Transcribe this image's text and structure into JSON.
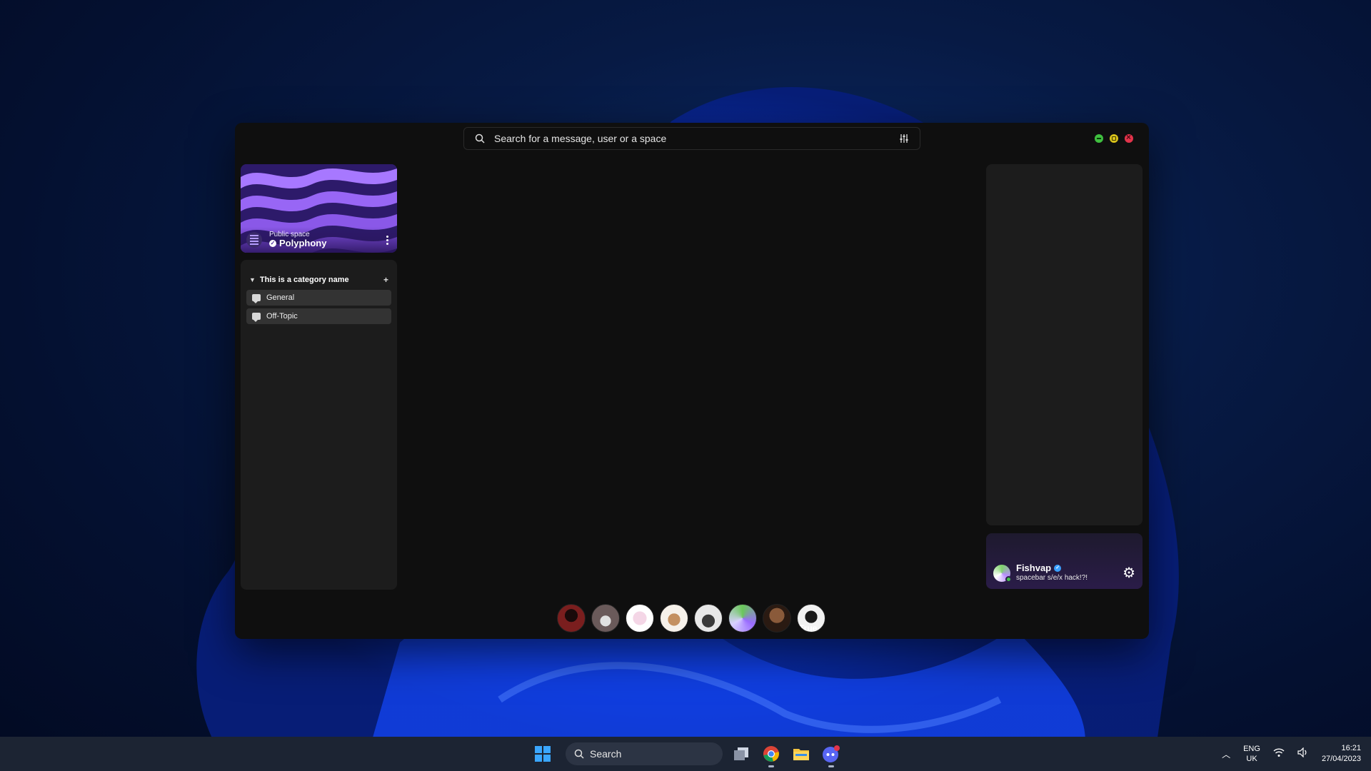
{
  "search": {
    "placeholder": "Search for a message, user or a space"
  },
  "space": {
    "kind": "Public space",
    "name": "Polyphony"
  },
  "category": {
    "name": "This is a category name",
    "add_label": "+"
  },
  "channels": [
    {
      "label": "General"
    },
    {
      "label": "Off-Topic"
    }
  ],
  "user": {
    "name": "Fishvap",
    "status": "spacebar s/e/x hack!?!"
  },
  "members": [
    {
      "label": ""
    },
    {
      "label": ""
    },
    {
      "label": ""
    },
    {
      "label": ""
    },
    {
      "label": ""
    },
    {
      "label": ""
    },
    {
      "label": ""
    },
    {
      "label": "True"
    }
  ],
  "taskbar": {
    "search_label": "Search",
    "lang_line1": "ENG",
    "lang_line2": "UK",
    "time": "16:21",
    "date": "27/04/2023"
  },
  "colors": {
    "accent_purple": "#9a6bff",
    "close": "#e2344b",
    "minimize": "#3fbf3f",
    "maximize": "#d8c21a"
  },
  "icons": [
    "search-icon",
    "filter-sliders-icon",
    "chat-bubble-icon",
    "gear-icon",
    "verified-icon",
    "chevron-down-icon",
    "kebab-menu-icon"
  ]
}
